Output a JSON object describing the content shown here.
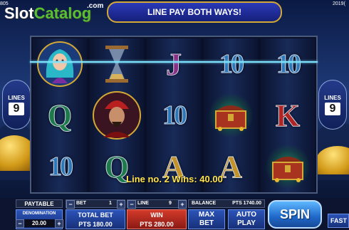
{
  "branding": {
    "logo_slot": "Slot",
    "logo_catalog": "Catalog",
    "logo_domain": ".com"
  },
  "corner_left": "805",
  "corner_right": "2019(",
  "banner": "LINE PAY BOTH WAYS!",
  "lines_left": {
    "label": "LINES",
    "value": "9"
  },
  "lines_right": {
    "label": "LINES",
    "value": "9"
  },
  "reels": [
    [
      "woman-portrait",
      "Q",
      "10"
    ],
    [
      "hourglass",
      "sultan-portrait",
      "Q"
    ],
    [
      "J",
      "10",
      "A"
    ],
    [
      "10",
      "treasure-chest",
      "A"
    ],
    [
      "10",
      "K",
      "treasure-chest"
    ]
  ],
  "win_message": "Line no. 2 Wins: 40.00",
  "controls": {
    "paytable": "PAYTABLE",
    "denomination_label": "DENOMINATION",
    "denomination_value": "20.00",
    "bet_label": "BET",
    "bet_value": "1",
    "line_label": "LINE",
    "line_value": "9",
    "total_bet_label": "TOTAL BET",
    "total_bet_value": "PTS 180.00",
    "win_label": "WIN",
    "win_value": "PTS 280.00",
    "balance_label": "BALANCE",
    "balance_value": "PTS 1740.00",
    "max_bet_line1": "MAX",
    "max_bet_line2": "BET",
    "auto_play_line1": "AUTO",
    "auto_play_line2": "PLAY",
    "spin": "SPIN",
    "fast": "FAST"
  },
  "colors": {
    "accent_gold": "#d4a834",
    "win_yellow": "#ffe34f",
    "payline_cyan": "#7de3ff",
    "brand_green": "#58c032"
  }
}
